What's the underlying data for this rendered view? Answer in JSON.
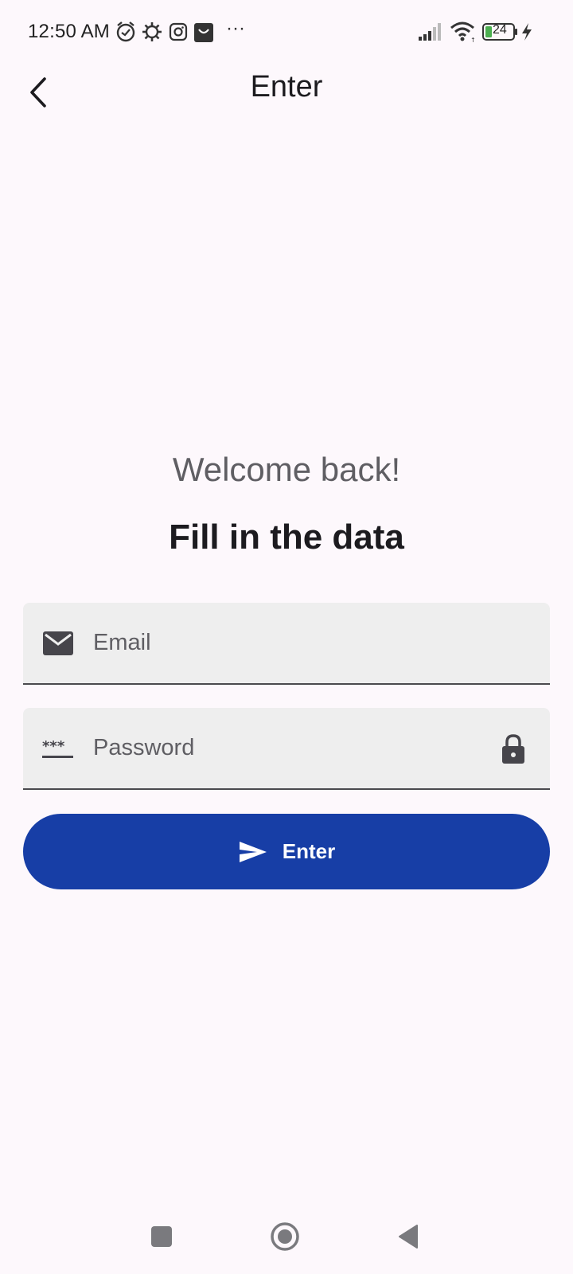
{
  "status_bar": {
    "time": "12:50 AM",
    "more": "···",
    "battery": "24",
    "icons": [
      "alarm-icon",
      "settings-icon",
      "instagram-icon",
      "shop-icon",
      "signal-icon",
      "wifi-icon",
      "battery-icon",
      "charging-icon"
    ]
  },
  "app_bar": {
    "title": "Enter",
    "back_icon": "chevron-left-icon"
  },
  "greeting": "Welcome back!",
  "subtitle": "Fill in the data",
  "form": {
    "email": {
      "placeholder": "Email",
      "value": "",
      "icon": "mail-icon"
    },
    "password": {
      "placeholder": "Password",
      "value": "",
      "icon": "password-dots-icon",
      "trailing_icon": "lock-icon"
    },
    "submit": {
      "label": "Enter",
      "icon": "send-icon"
    }
  },
  "nav_bar": {
    "items": [
      "recents-square-icon",
      "home-circle-icon",
      "back-triangle-icon"
    ]
  },
  "colors": {
    "background": "#fdf8fc",
    "primary": "#173ea6",
    "field_bg": "#eeeeee",
    "text_secondary": "#5f5e63"
  }
}
